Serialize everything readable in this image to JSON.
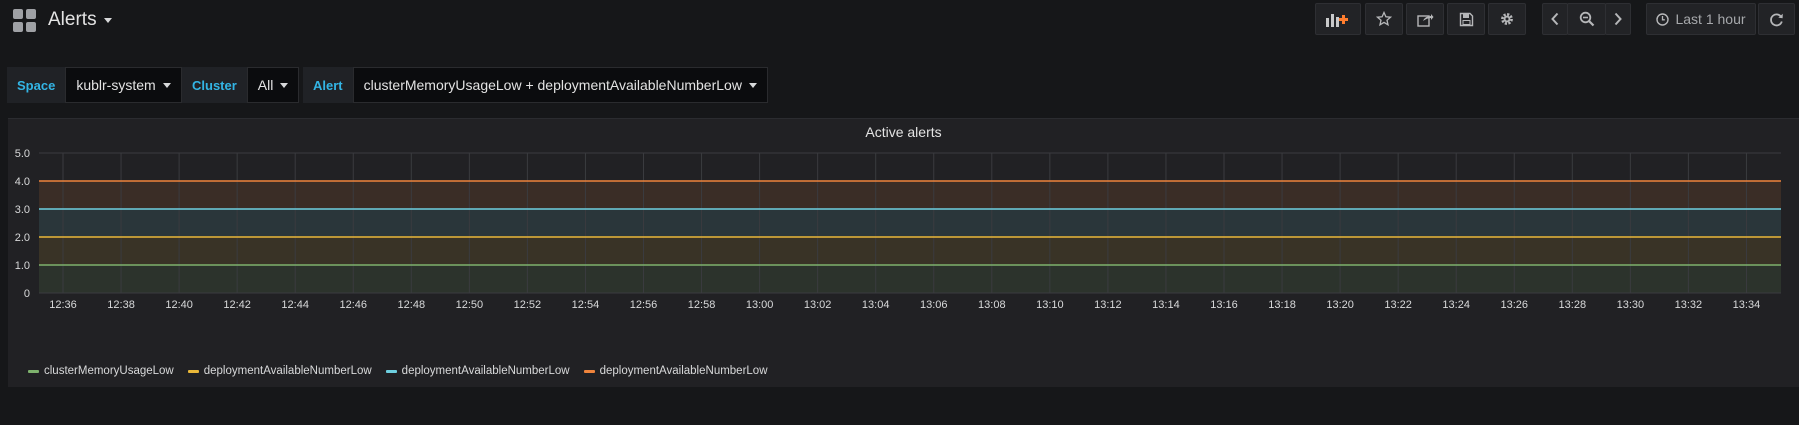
{
  "dashboard": {
    "title": "Alerts"
  },
  "toolbar": {
    "time_range": "Last 1 hour"
  },
  "variables": [
    {
      "label": "Space",
      "value": "kublr-system"
    },
    {
      "label": "Cluster",
      "value": "All"
    },
    {
      "label": "Alert",
      "value": "clusterMemoryUsageLow + deploymentAvailableNumberLow"
    }
  ],
  "panel": {
    "title": "Active alerts"
  },
  "chart_data": {
    "type": "area",
    "title": "Active alerts",
    "ylim": [
      0,
      5
    ],
    "y_ticks": [
      "0",
      "1.0",
      "2.0",
      "3.0",
      "4.0",
      "5.0"
    ],
    "x": [
      "12:36",
      "12:38",
      "12:40",
      "12:42",
      "12:44",
      "12:46",
      "12:48",
      "12:50",
      "12:52",
      "12:54",
      "12:56",
      "12:58",
      "13:00",
      "13:02",
      "13:04",
      "13:06",
      "13:08",
      "13:10",
      "13:12",
      "13:14",
      "13:16",
      "13:18",
      "13:20",
      "13:22",
      "13:24",
      "13:26",
      "13:28",
      "13:30",
      "13:32",
      "13:34"
    ],
    "stacked": true,
    "series": [
      {
        "name": "clusterMemoryUsageLow",
        "color": "#7eb26d",
        "value": 1
      },
      {
        "name": "deploymentAvailableNumberLow",
        "color": "#eab839",
        "value": 1
      },
      {
        "name": "deploymentAvailableNumberLow",
        "color": "#6ed0e0",
        "value": 1
      },
      {
        "name": "deploymentAvailableNumberLow",
        "color": "#ef843c",
        "value": 1
      }
    ],
    "grid": true,
    "legend": "bottom-left"
  }
}
